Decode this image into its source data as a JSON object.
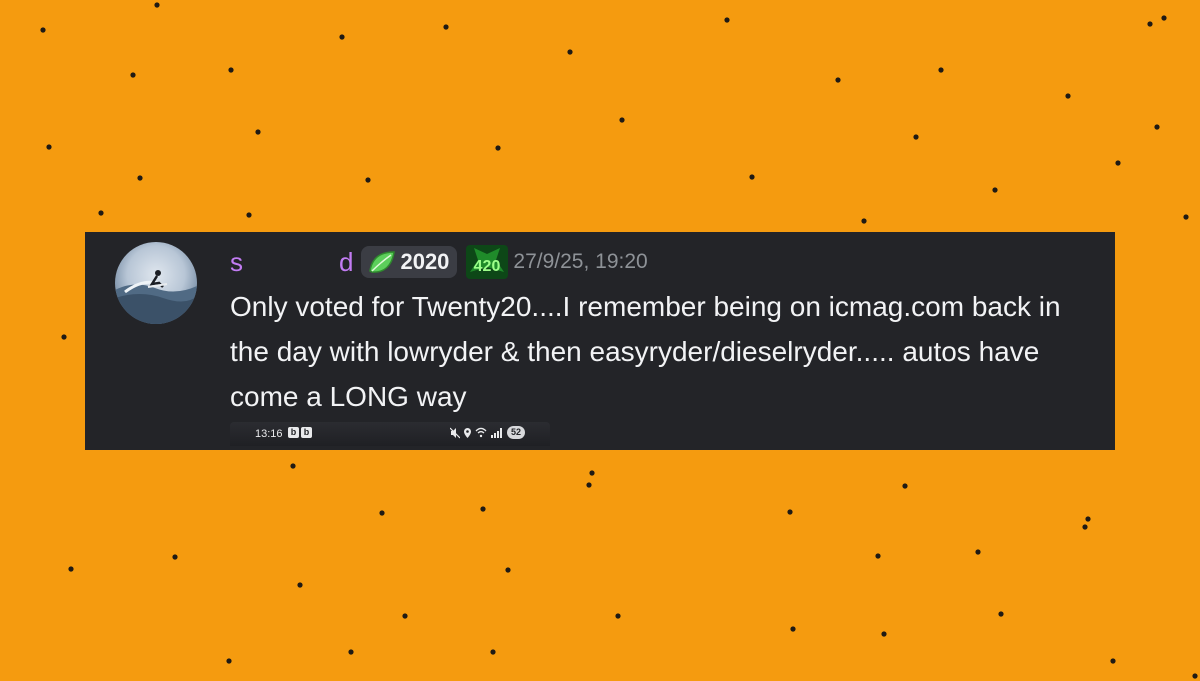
{
  "message": {
    "author_visible_start": "s",
    "author_visible_end": "d",
    "tag_year": "2020",
    "role_icon_text": "420",
    "timestamp": "27/9/25, 19:20",
    "body": "Only voted for Twenty20....I remember being on icmag.com back in the day with lowryder & then easyryder/dieselryder..... autos have come a LONG way"
  },
  "embedded_status_bar": {
    "time": "13:16",
    "app_icons": [
      "b",
      "b"
    ],
    "battery": "52"
  },
  "colors": {
    "background": "#f59b0f",
    "card": "#232428",
    "username": "#c27cf3",
    "text": "#f2f3f5",
    "timestamp": "#8e9297"
  },
  "icons": {
    "tag": "leaf-icon",
    "role": "420-badge-icon",
    "status": [
      "mute-icon",
      "location-icon",
      "wifi-icon",
      "signal-icon"
    ]
  }
}
